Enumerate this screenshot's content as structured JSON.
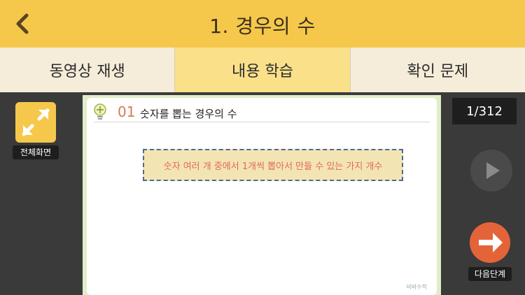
{
  "header": {
    "title": "1. 경우의 수",
    "back_icon": "chevron-left-icon"
  },
  "tabs": [
    {
      "label": "동영상 재생",
      "active": false
    },
    {
      "label": "내용 학습",
      "active": true
    },
    {
      "label": "확인 문제",
      "active": false
    }
  ],
  "left_panel": {
    "fullscreen_label": "전체화면",
    "fullscreen_icon": "expand-arrows-icon"
  },
  "content": {
    "section_number": "01",
    "section_title": "숫자를 뽑는 경우의 수",
    "callout_text": "숫자 여러 개 중에서 1개씩 뽑아서 만들 수 있는 가지 개수",
    "watermark": "비바수학"
  },
  "right_panel": {
    "page_indicator": "1/312",
    "play_icon": "play-icon",
    "next_label": "다음단계",
    "next_icon": "arrow-right-icon"
  },
  "colors": {
    "header_bg": "#f5c84c",
    "tab_active_bg": "#fbe08a",
    "tab_bg": "#f5ecd9",
    "next_button": "#e4643a",
    "callout_text": "#e06a5a"
  }
}
